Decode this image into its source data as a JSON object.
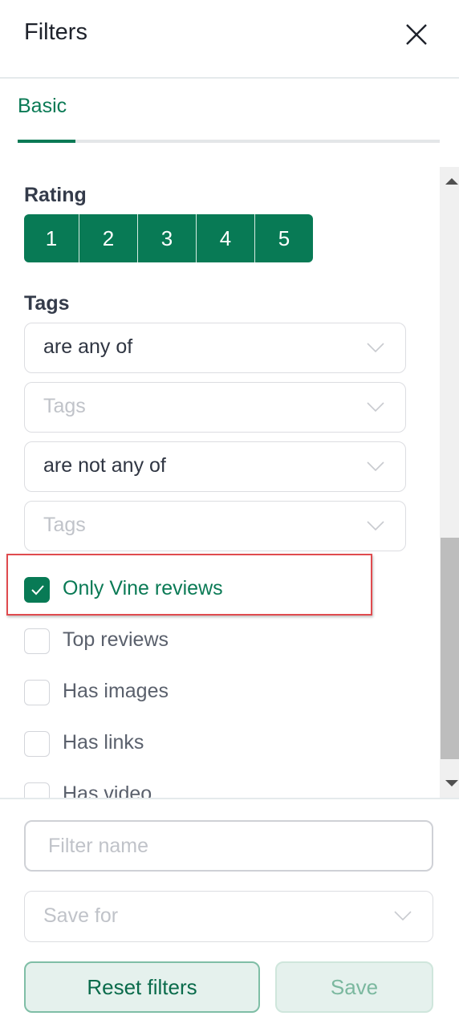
{
  "header": {
    "title": "Filters",
    "close_icon": "close-icon"
  },
  "tabs": [
    {
      "label": "Basic",
      "active": true
    }
  ],
  "rating": {
    "label": "Rating",
    "options": [
      "1",
      "2",
      "3",
      "4",
      "5"
    ]
  },
  "tags": {
    "label": "Tags",
    "include_operator": "are any of",
    "include_placeholder": "Tags",
    "exclude_operator": "are not any of",
    "exclude_placeholder": "Tags"
  },
  "checkboxes": [
    {
      "label": "Only Vine reviews",
      "checked": true
    },
    {
      "label": "Top reviews",
      "checked": false
    },
    {
      "label": "Has images",
      "checked": false
    },
    {
      "label": "Has links",
      "checked": false
    },
    {
      "label": "Has video",
      "checked": false
    }
  ],
  "footer": {
    "filter_name_placeholder": "Filter name",
    "save_for_placeholder": "Save for",
    "reset_label": "Reset filters",
    "save_label": "Save"
  },
  "colors": {
    "accent": "#087a55",
    "highlight": "#e04b4f"
  }
}
